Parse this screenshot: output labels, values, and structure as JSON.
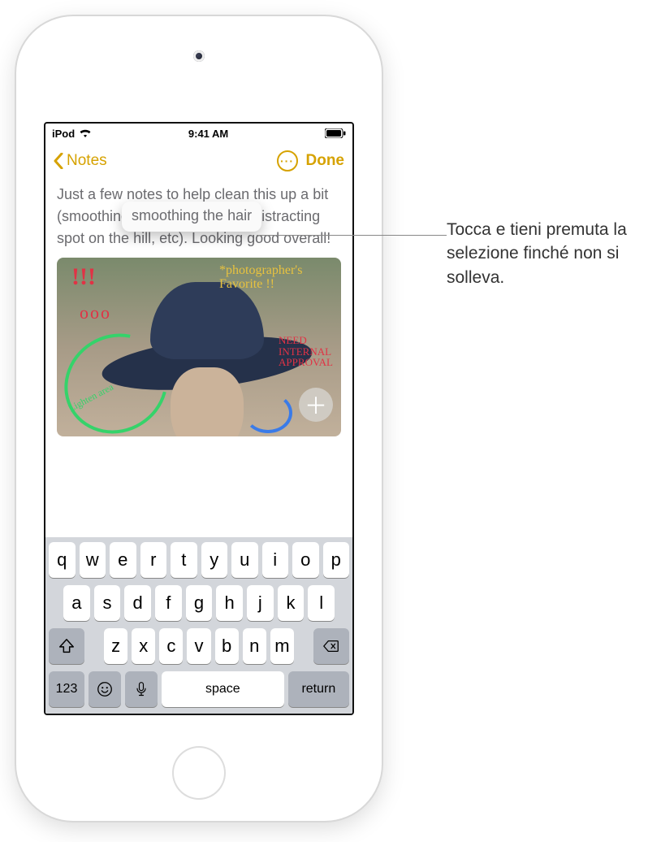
{
  "status": {
    "carrier": "iPod",
    "time": "9:41 AM"
  },
  "nav": {
    "back": "Notes",
    "done": "Done",
    "more": "···"
  },
  "note": {
    "text": "Just a few notes to help clean this up a bit (smoothing the hair, removing distracting spot on the hill, etc). Looking good overall!",
    "lifted": "smoothing the hair"
  },
  "annotations": {
    "red_excl": "!!!",
    "red_ooo": "ooo",
    "fav": "*photographer's Favorite !!",
    "need": "NEED\nINTERNAL\nAPPROVAL",
    "lighten": "Lighten area"
  },
  "plus": "＋",
  "kbd": {
    "row1": [
      "q",
      "w",
      "e",
      "r",
      "t",
      "y",
      "u",
      "i",
      "o",
      "p"
    ],
    "row2": [
      "a",
      "s",
      "d",
      "f",
      "g",
      "h",
      "j",
      "k",
      "l"
    ],
    "row3": [
      "z",
      "x",
      "c",
      "v",
      "b",
      "n",
      "m"
    ],
    "n123": "123",
    "space": "space",
    "ret": "return"
  },
  "callout": "Tocca e tieni premuta la selezione finché non si solleva."
}
